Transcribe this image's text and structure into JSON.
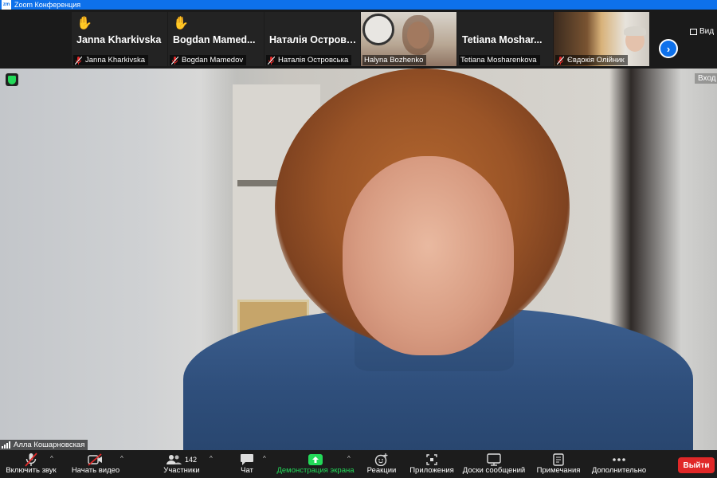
{
  "window": {
    "app_icon_text": "zm",
    "title": "Zoom Конференция"
  },
  "gallery": {
    "tiles": [
      {
        "display_name": "Janna Kharkivska",
        "label": "Janna Kharkivska",
        "hand_raised": true,
        "muted": true
      },
      {
        "display_name": "Bogdan  Mamed...",
        "label": "Bogdan Mamedov",
        "hand_raised": true,
        "muted": true
      },
      {
        "display_name": "Наталія  Островсь...",
        "label": "Наталія Островська",
        "hand_raised": false,
        "muted": true
      },
      {
        "display_name": "",
        "label": "Halyna Bozhenko",
        "hand_raised": false,
        "muted": false,
        "video": true
      },
      {
        "display_name": "Tetiana  Moshar...",
        "label": "Tetiana Mosharenkova",
        "hand_raised": false,
        "muted": false
      },
      {
        "display_name": "",
        "label": "Євдокія Олійник",
        "hand_raised": false,
        "muted": true,
        "video": true
      }
    ],
    "next_button": "›",
    "view_label": "Вид"
  },
  "main": {
    "exit_label": "Вход",
    "speaker_name": "Алла Кошарновская"
  },
  "toolbar": {
    "unmute": "Включить звук",
    "start_video": "Начать видео",
    "participants": "Участники",
    "participants_count": "142",
    "chat": "Чат",
    "share_screen": "Демонстрация экрана",
    "reactions": "Реакции",
    "apps": "Приложения",
    "whiteboards": "Доски сообщений",
    "notes": "Примечания",
    "more": "Дополнительно",
    "leave": "Выйти"
  },
  "colors": {
    "accent": "#0e71eb",
    "share_green": "#23d959",
    "leave_red": "#e02828",
    "mic_off_red": "#e02828"
  }
}
